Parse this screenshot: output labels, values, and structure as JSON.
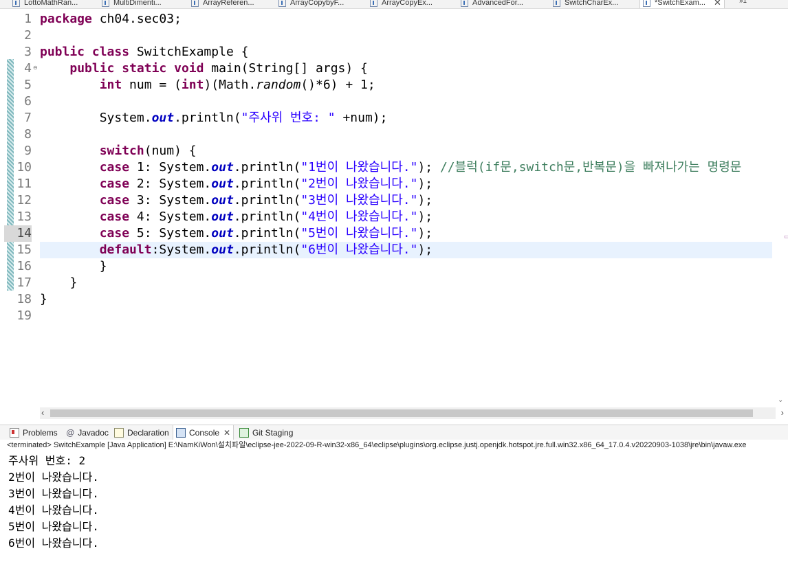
{
  "tabs": [
    {
      "label": "LottoMathRan..."
    },
    {
      "label": "MultiDimenti..."
    },
    {
      "label": "ArrayReferen..."
    },
    {
      "label": "ArrayCopybyF..."
    },
    {
      "label": "ArrayCopyEx..."
    },
    {
      "label": "AdvancedFor..."
    },
    {
      "label": "SwitchCharEx..."
    },
    {
      "label": "*SwitchExam..."
    }
  ],
  "tab_overflow": "»1",
  "editor": {
    "lines": [
      {
        "n": "1",
        "parts": [
          {
            "t": "package",
            "c": "kw"
          },
          {
            "t": " ch04.sec03;"
          }
        ]
      },
      {
        "n": "2",
        "parts": []
      },
      {
        "n": "3",
        "parts": [
          {
            "t": "public",
            "c": "kw"
          },
          {
            "t": " "
          },
          {
            "t": "class",
            "c": "kw"
          },
          {
            "t": " SwitchExample {"
          }
        ]
      },
      {
        "n": "4",
        "fold": "⊖",
        "parts": [
          {
            "t": "    "
          },
          {
            "t": "public",
            "c": "kw"
          },
          {
            "t": " "
          },
          {
            "t": "static",
            "c": "kw"
          },
          {
            "t": " "
          },
          {
            "t": "void",
            "c": "kw"
          },
          {
            "t": " main(String[] args) {"
          }
        ]
      },
      {
        "n": "5",
        "parts": [
          {
            "t": "        "
          },
          {
            "t": "int",
            "c": "kw"
          },
          {
            "t": " num = ("
          },
          {
            "t": "int",
            "c": "kw"
          },
          {
            "t": ")(Math."
          },
          {
            "t": "random",
            "c": "it"
          },
          {
            "t": "()*6) + 1;"
          }
        ]
      },
      {
        "n": "6",
        "parts": []
      },
      {
        "n": "7",
        "parts": [
          {
            "t": "        System."
          },
          {
            "t": "out",
            "c": "fi"
          },
          {
            "t": ".println("
          },
          {
            "t": "\"주사위 번호: \"",
            "c": "st"
          },
          {
            "t": " +num);"
          }
        ]
      },
      {
        "n": "8",
        "parts": []
      },
      {
        "n": "9",
        "parts": [
          {
            "t": "        "
          },
          {
            "t": "switch",
            "c": "kw"
          },
          {
            "t": "(num) {"
          }
        ]
      },
      {
        "n": "10",
        "parts": [
          {
            "t": "        "
          },
          {
            "t": "case",
            "c": "kw"
          },
          {
            "t": " 1: System."
          },
          {
            "t": "out",
            "c": "fi"
          },
          {
            "t": ".println("
          },
          {
            "t": "\"1번이 나왔습니다.\"",
            "c": "st"
          },
          {
            "t": "); "
          },
          {
            "t": "//블럭(if문,switch문,반복문)을 빠져나가는 명령문",
            "c": "cm"
          }
        ]
      },
      {
        "n": "11",
        "parts": [
          {
            "t": "        "
          },
          {
            "t": "case",
            "c": "kw"
          },
          {
            "t": " 2: System."
          },
          {
            "t": "out",
            "c": "fi"
          },
          {
            "t": ".println("
          },
          {
            "t": "\"2번이 나왔습니다.\"",
            "c": "st"
          },
          {
            "t": ");"
          }
        ]
      },
      {
        "n": "12",
        "parts": [
          {
            "t": "        "
          },
          {
            "t": "case",
            "c": "kw"
          },
          {
            "t": " 3: System."
          },
          {
            "t": "out",
            "c": "fi"
          },
          {
            "t": ".println("
          },
          {
            "t": "\"3번이 나왔습니다.\"",
            "c": "st"
          },
          {
            "t": ");"
          }
        ]
      },
      {
        "n": "13",
        "parts": [
          {
            "t": "        "
          },
          {
            "t": "case",
            "c": "kw"
          },
          {
            "t": " 4: System."
          },
          {
            "t": "out",
            "c": "fi"
          },
          {
            "t": ".println("
          },
          {
            "t": "\"4번이 나왔습니다.\"",
            "c": "st"
          },
          {
            "t": ");"
          }
        ]
      },
      {
        "n": "14",
        "current": true,
        "parts": [
          {
            "t": "        "
          },
          {
            "t": "case",
            "c": "kw"
          },
          {
            "t": " 5: System."
          },
          {
            "t": "out",
            "c": "fi"
          },
          {
            "t": ".println("
          },
          {
            "t": "\"5번이 나왔습니다.\"",
            "c": "st"
          },
          {
            "t": ");"
          }
        ]
      },
      {
        "n": "15",
        "highlight": true,
        "parts": [
          {
            "t": "        "
          },
          {
            "t": "default",
            "c": "kw"
          },
          {
            "t": ":System."
          },
          {
            "t": "out",
            "c": "fi"
          },
          {
            "t": ".println("
          },
          {
            "t": "\"6번이 나왔습니다.\"",
            "c": "st"
          },
          {
            "t": ");"
          }
        ]
      },
      {
        "n": "16",
        "parts": [
          {
            "t": "        }"
          }
        ]
      },
      {
        "n": "17",
        "parts": [
          {
            "t": "    }"
          }
        ]
      },
      {
        "n": "18",
        "parts": [
          {
            "t": "}"
          }
        ]
      },
      {
        "n": "19",
        "parts": []
      }
    ]
  },
  "panel_tabs": {
    "problems": "Problems",
    "javadoc": "Javadoc",
    "declaration": "Declaration",
    "console": "Console",
    "git": "Git Staging"
  },
  "console": {
    "terminated": "<terminated> SwitchExample [Java Application] E:\\NamKiWon\\설치파일\\eclipse-jee-2022-09-R-win32-x86_64\\eclipse\\plugins\\org.eclipse.justj.openjdk.hotspot.jre.full.win32.x86_64_17.0.4.v20220903-1038\\jre\\bin\\javaw.exe",
    "output": [
      "주사위 번호: 2",
      "2번이 나왔습니다.",
      "3번이 나왔습니다.",
      "4번이 나왔습니다.",
      "5번이 나왔습니다.",
      "6번이 나왔습니다."
    ]
  },
  "colors": {
    "keyword": "#7f0055",
    "string": "#2a00ff",
    "field": "#0000c0",
    "comment": "#3f7f5f",
    "current_line": "#e8f2fe"
  }
}
